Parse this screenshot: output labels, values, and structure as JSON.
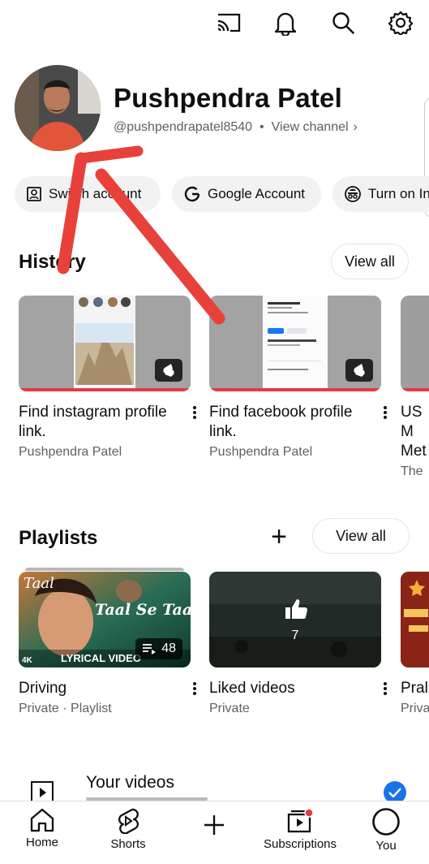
{
  "topbar": {
    "icons": [
      "cast-icon",
      "bell-icon",
      "search-icon",
      "gear-icon"
    ]
  },
  "profile": {
    "name": "Pushpendra Patel",
    "handle": "@pushpendrapatel8540",
    "separator": "•",
    "view_channel": "View channel",
    "chevron": "›"
  },
  "chips": [
    {
      "label": "Switch account",
      "icon": "switch-account-icon"
    },
    {
      "label": "Google Account",
      "icon": "google-g-icon"
    },
    {
      "label": "Turn on Incognito",
      "icon": "incognito-icon"
    }
  ],
  "history": {
    "title": "History",
    "view_all": "View all",
    "items": [
      {
        "title": "Find instagram profile link.",
        "channel": "Pushpendra Patel"
      },
      {
        "title": "Find facebook profile link.",
        "channel": "Pushpendra Patel"
      },
      {
        "title": "US M Met",
        "channel": "The"
      }
    ]
  },
  "playlists": {
    "title": "Playlists",
    "add_symbol": "+",
    "view_all": "View all",
    "items": [
      {
        "title": "Driving",
        "subtitle": "Private · Playlist",
        "count": "48",
        "thumb_text": "Taal Se Taal",
        "thumb_corner": "Taal",
        "thumb_banner": "LYRICAL VIDEO",
        "thumb_quality": "4K"
      },
      {
        "title": "Liked videos",
        "subtitle": "Private",
        "count": "7"
      },
      {
        "title": "Pral",
        "subtitle": "Priva"
      }
    ]
  },
  "your_videos": {
    "label": "Your videos"
  },
  "nav": [
    {
      "label": "Home",
      "icon": "home-icon"
    },
    {
      "label": "Shorts",
      "icon": "shorts-icon"
    },
    {
      "label": "",
      "icon": "create-plus-icon"
    },
    {
      "label": "Subscriptions",
      "icon": "subscriptions-icon"
    },
    {
      "label": "You",
      "icon": "you-avatar-icon"
    }
  ],
  "colors": {
    "accent_red": "#e53945",
    "text_primary": "#0f0f0f",
    "text_secondary": "#606060",
    "chip_bg": "#f2f2f2",
    "annotation_arrow": "#e8413b",
    "check_blue": "#1a73e8"
  }
}
